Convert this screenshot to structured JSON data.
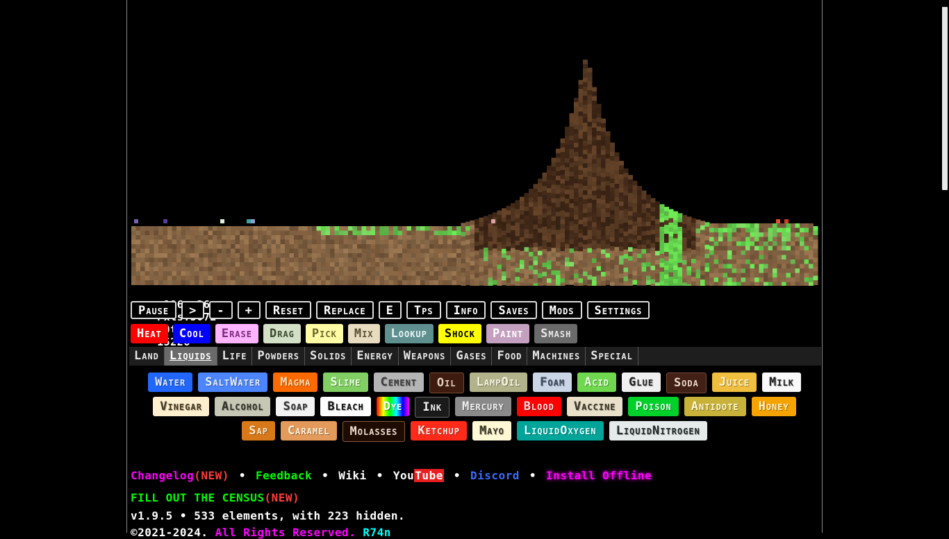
{
  "stats": {
    "coords": "x196,y26",
    "pixels": "Pxls:3072",
    "tps": "30tps",
    "ticks": "15226"
  },
  "controls": [
    {
      "id": "pause",
      "label": "Pause"
    },
    {
      "id": "step",
      "label": ">"
    },
    {
      "id": "minus",
      "label": "-"
    },
    {
      "id": "plus",
      "label": "+"
    },
    {
      "id": "reset",
      "label": "Reset"
    },
    {
      "id": "replace",
      "label": "Replace"
    },
    {
      "id": "e",
      "label": "E"
    },
    {
      "id": "tps",
      "label": "Tps"
    },
    {
      "id": "info",
      "label": "Info"
    },
    {
      "id": "saves",
      "label": "Saves"
    },
    {
      "id": "mods",
      "label": "Mods"
    },
    {
      "id": "settings",
      "label": "Settings"
    }
  ],
  "tools": [
    {
      "id": "heat",
      "label": "Heat",
      "bg": "#ff0000",
      "fg": "#ffffff"
    },
    {
      "id": "cool",
      "label": "Cool",
      "bg": "#0000ff",
      "fg": "#ffffff"
    },
    {
      "id": "erase",
      "label": "Erase",
      "bg": "#fdb5ff",
      "fg": "#7a2a7a"
    },
    {
      "id": "drag",
      "label": "Drag",
      "bg": "#d3e0c6",
      "fg": "#3a4a2e"
    },
    {
      "id": "pick",
      "label": "Pick",
      "bg": "#fffca5",
      "fg": "#6b6a2a"
    },
    {
      "id": "mix",
      "label": "Mix",
      "bg": "#e8dcc0",
      "fg": "#5a4e30"
    },
    {
      "id": "lookup",
      "label": "Lookup",
      "bg": "#5f8f8f",
      "fg": "#e9f5f5"
    },
    {
      "id": "shock",
      "label": "Shock",
      "bg": "#ffff00",
      "fg": "#000000"
    },
    {
      "id": "paint",
      "label": "Paint",
      "bg": "#c4a0c0",
      "fg": "#ffffff"
    },
    {
      "id": "smash",
      "label": "Smash",
      "bg": "#6a6a6a",
      "fg": "#e8e8e8"
    }
  ],
  "tabs": [
    {
      "id": "land",
      "label": "Land"
    },
    {
      "id": "liquids",
      "label": "Liquids",
      "active": true
    },
    {
      "id": "life",
      "label": "Life"
    },
    {
      "id": "powders",
      "label": "Powders"
    },
    {
      "id": "solids",
      "label": "Solids"
    },
    {
      "id": "energy",
      "label": "Energy"
    },
    {
      "id": "weapons",
      "label": "Weapons"
    },
    {
      "id": "gases",
      "label": "Gases"
    },
    {
      "id": "food",
      "label": "Food"
    },
    {
      "id": "machines",
      "label": "Machines"
    },
    {
      "id": "special",
      "label": "Special"
    }
  ],
  "elements": [
    {
      "id": "water",
      "label": "Water",
      "bg": "#2167ff",
      "fg": "#dfe9ff"
    },
    {
      "id": "saltwater",
      "label": "SaltWater",
      "bg": "#4d85ff",
      "fg": "#e5eeff"
    },
    {
      "id": "magma",
      "label": "Magma",
      "bg": "#ff6a00",
      "fg": "#ffe0b0"
    },
    {
      "id": "slime",
      "label": "Slime",
      "bg": "#81cf63",
      "fg": "#e9ffe0"
    },
    {
      "id": "cement",
      "label": "Cement",
      "bg": "#b5b5b5",
      "fg": "#3c3c3c"
    },
    {
      "id": "oil",
      "label": "Oil",
      "bg": "#3d1c0f",
      "fg": "#e8d0c0",
      "border": "#7a4a30"
    },
    {
      "id": "lampoil",
      "label": "LampOil",
      "bg": "#b3b38b",
      "fg": "#f5f5e0"
    },
    {
      "id": "foam",
      "label": "Foam",
      "bg": "#cad6e8",
      "fg": "#3c4a60"
    },
    {
      "id": "acid",
      "label": "Acid",
      "bg": "#6fd84f",
      "fg": "#e8ffe0"
    },
    {
      "id": "glue",
      "label": "Glue",
      "bg": "#f0f0f0",
      "fg": "#222222"
    },
    {
      "id": "soda",
      "label": "Soda",
      "bg": "#422016",
      "fg": "#f0d8c8",
      "border": "#7a4a30"
    },
    {
      "id": "juice",
      "label": "Juice",
      "bg": "#f0bf3f",
      "fg": "#fff5d0"
    },
    {
      "id": "milk",
      "label": "Milk",
      "bg": "#fafafa",
      "fg": "#222222"
    },
    {
      "id": "vinegar",
      "label": "Vinegar",
      "bg": "#ffefcf",
      "fg": "#443a20"
    },
    {
      "id": "alcohol",
      "label": "Alcohol",
      "bg": "#c7c7b5",
      "fg": "#33332a"
    },
    {
      "id": "soap",
      "label": "Soap",
      "bg": "#f2f2f2",
      "fg": "#333333"
    },
    {
      "id": "bleach",
      "label": "Bleach",
      "bg": "#ffffff",
      "fg": "#111111"
    },
    {
      "id": "dye",
      "label": "Dye",
      "bg": "rainbow",
      "fg": "#ffffff"
    },
    {
      "id": "ink",
      "label": "Ink",
      "bg": "#1a1a1a",
      "fg": "#f0f0f0",
      "border": "#6a6a6a"
    },
    {
      "id": "mercury",
      "label": "Mercury",
      "bg": "#8a8a8a",
      "fg": "#f0f0f0"
    },
    {
      "id": "blood",
      "label": "Blood",
      "bg": "#ff0000",
      "fg": "#ffe0e0"
    },
    {
      "id": "vaccine",
      "label": "Vaccine",
      "bg": "#e8e0c8",
      "fg": "#3a3426"
    },
    {
      "id": "poison",
      "label": "Poison",
      "bg": "#00d12a",
      "fg": "#e0ffe8"
    },
    {
      "id": "antidote",
      "label": "Antidote",
      "bg": "#c8b23a",
      "fg": "#fff8d0"
    },
    {
      "id": "honey",
      "label": "Honey",
      "bg": "#f5a300",
      "fg": "#fff2c8"
    },
    {
      "id": "sap",
      "label": "Sap",
      "bg": "#d7791a",
      "fg": "#ffe8c8"
    },
    {
      "id": "caramel",
      "label": "Caramel",
      "bg": "#e39a5a",
      "fg": "#fff0dc"
    },
    {
      "id": "molasses",
      "label": "Molasses",
      "bg": "#1e0c03",
      "fg": "#f0dccc",
      "border": "#8a5a3a"
    },
    {
      "id": "ketchup",
      "label": "Ketchup",
      "bg": "#ff2a1a",
      "fg": "#ffe8e0"
    },
    {
      "id": "mayo",
      "label": "Mayo",
      "bg": "#fff8d4",
      "fg": "#3a3626"
    },
    {
      "id": "liquidoxygen",
      "label": "LiquidOxygen",
      "bg": "#00a59a",
      "fg": "#e0fffc"
    },
    {
      "id": "liquidnitrogen",
      "label": "LiquidNitrogen",
      "bg": "#e4ebea",
      "fg": "#222a2a"
    }
  ],
  "links": {
    "changelog": "Changelog",
    "changelog_new": "(NEW)",
    "feedback": "Feedback",
    "wiki": "Wiki",
    "you": "You",
    "tube": "Tube",
    "discord": "Discord",
    "install": "Install Offline",
    "sep": "•"
  },
  "census": {
    "text": "FILL OUT THE CENSUS",
    "new": "(NEW)"
  },
  "version": "v1.9.5 • 533 elements, with 223 hidden.",
  "copyright": {
    "prefix": "©2021-2024.",
    "rights": "All Rights Reserved.",
    "author": "R74n"
  },
  "colors": {
    "dirt": "#8a6a48",
    "dirt_dark": "#7a5a3c",
    "grass": "#74c85a",
    "grass_bright": "#63cf4c",
    "mound": "#5a3c24",
    "mound_dark": "#3e2616",
    "changelog": "#ff00ff",
    "feedback": "#00ff00",
    "discord": "#3b6cff",
    "install": "#ff00ff"
  }
}
